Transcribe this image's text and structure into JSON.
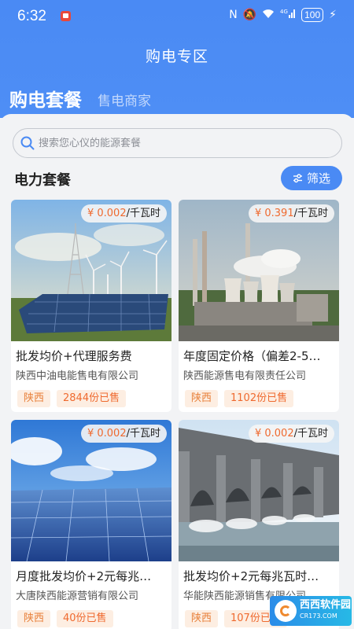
{
  "status_bar": {
    "time": "6:32",
    "network": "4G",
    "battery": "100"
  },
  "header": {
    "title": "购电专区",
    "tabs": [
      {
        "label": "购电套餐",
        "active": true
      },
      {
        "label": "售电商家",
        "active": false
      }
    ]
  },
  "search": {
    "placeholder": "搜索您心仪的能源套餐"
  },
  "section": {
    "title": "电力套餐",
    "filter_label": "筛选"
  },
  "packages": [
    {
      "price": "¥ 0.002",
      "unit": "/千瓦时",
      "name": "批发均价+代理服务费",
      "company": "陕西中油电能售电有限公司",
      "region": "陕西",
      "sold": "2844份已售",
      "image": "solar-wind-field"
    },
    {
      "price": "¥ 0.391",
      "unit": "/千瓦时",
      "name": "年度固定价格（偏差2-5…",
      "company": "陕西能源售电有限责任公司",
      "region": "陕西",
      "sold": "1102份已售",
      "image": "power-plant"
    },
    {
      "price": "¥ 0.002",
      "unit": "/千瓦时",
      "name": "月度批发均价+2元每兆…",
      "company": "大唐陕西能源营销有限公司",
      "region": "陕西",
      "sold": "40份已售",
      "image": "solar-panels-sky"
    },
    {
      "price": "¥ 0.002",
      "unit": "/千瓦时",
      "name": "批发均价+2元每兆瓦时…",
      "company": "华能陕西能源销售有限公司",
      "region": "陕西",
      "sold": "107份已售",
      "image": "hydro-dam"
    }
  ],
  "watermark": {
    "title": "西西软件园",
    "sub": "CR173.COM"
  },
  "colors": {
    "header": "#4a8af4",
    "accent": "#4a8af4",
    "price": "#ef6a2f",
    "tag_bg": "#fdeee2"
  }
}
